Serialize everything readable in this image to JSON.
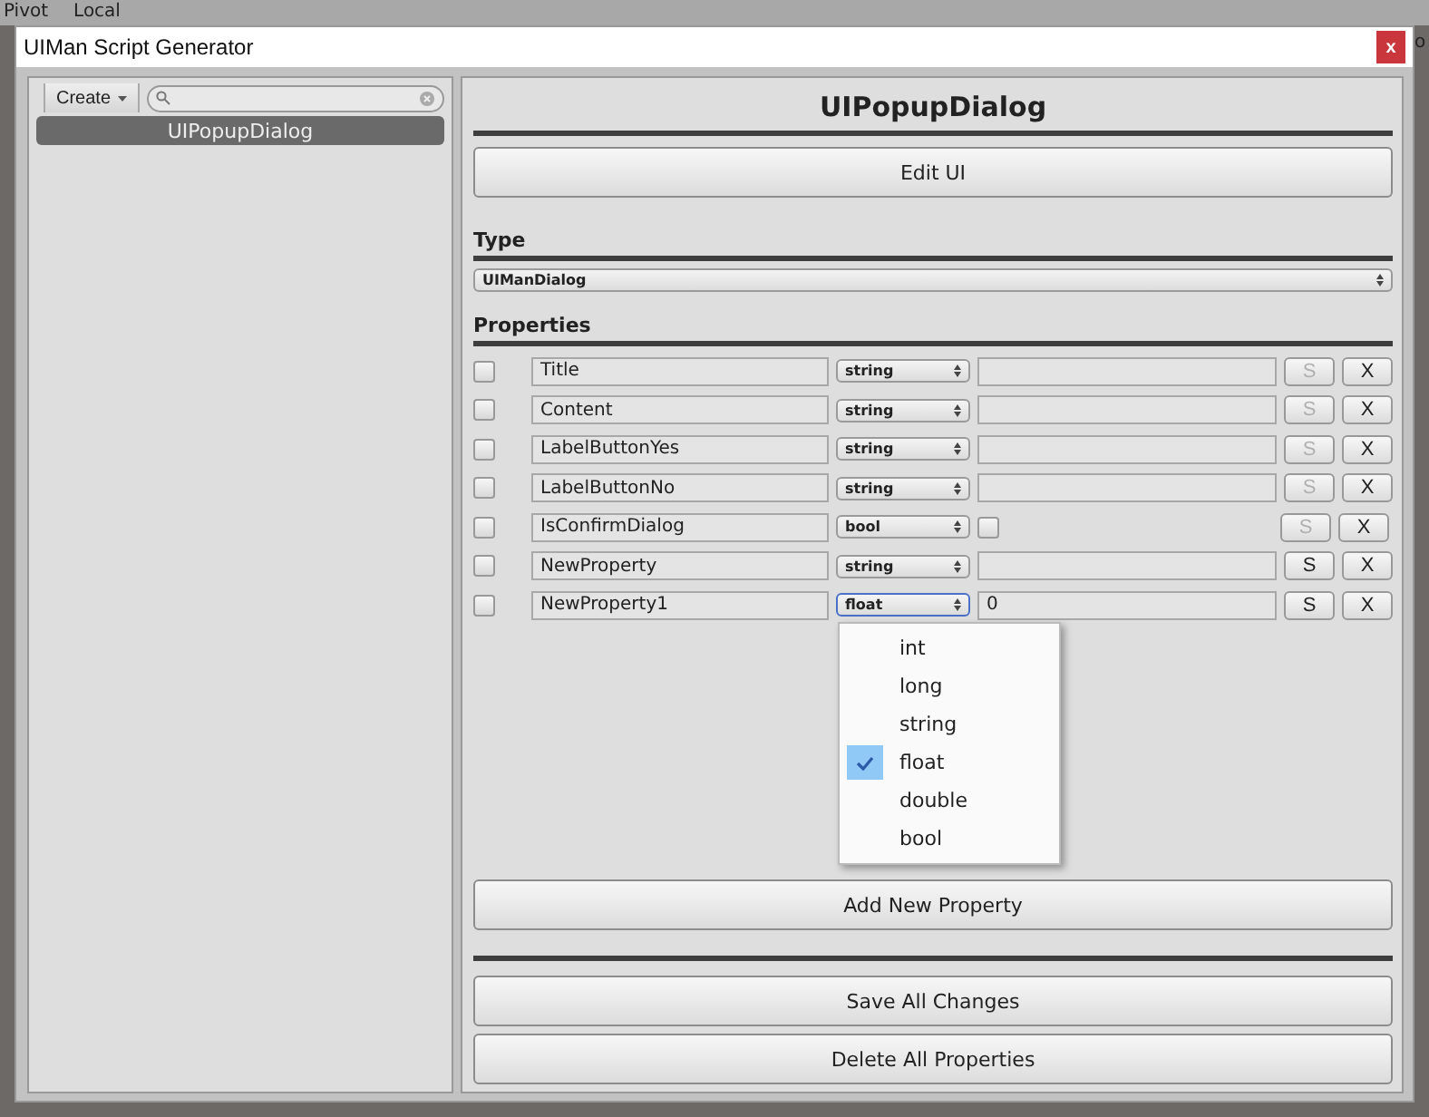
{
  "background": {
    "toolbar_items": [
      "Pivot",
      "Local"
    ],
    "side_text": "o"
  },
  "window": {
    "title": "UIMan Script Generator",
    "close_label": "x"
  },
  "sidebar": {
    "create_button": "Create",
    "items": [
      {
        "label": "UIPopupDialog",
        "selected": true
      }
    ]
  },
  "editor": {
    "title": "UIPopupDialog",
    "edit_button": "Edit UI",
    "type_label": "Type",
    "type_value": "UIManDialog",
    "properties_label": "Properties",
    "properties": [
      {
        "checked": false,
        "name": "Title",
        "type": "string",
        "kind": "text",
        "focused": false,
        "save_enabled": false,
        "save_label": "S",
        "remove_label": "X"
      },
      {
        "checked": false,
        "name": "Content",
        "type": "string",
        "kind": "text",
        "focused": false,
        "save_enabled": false,
        "save_label": "S",
        "remove_label": "X"
      },
      {
        "checked": false,
        "name": "LabelButtonYes",
        "type": "string",
        "kind": "text",
        "focused": false,
        "save_enabled": false,
        "save_label": "S",
        "remove_label": "X"
      },
      {
        "checked": false,
        "name": "LabelButtonNo",
        "type": "string",
        "kind": "text",
        "focused": false,
        "save_enabled": false,
        "save_label": "S",
        "remove_label": "X"
      },
      {
        "checked": false,
        "name": "IsConfirmDialog",
        "type": "bool",
        "kind": "bool",
        "value_checked": false,
        "focused": false,
        "save_enabled": false,
        "save_label": "S",
        "remove_label": "X"
      },
      {
        "checked": false,
        "name": "NewProperty",
        "type": "string",
        "kind": "text",
        "focused": false,
        "save_enabled": true,
        "save_label": "S",
        "remove_label": "X"
      },
      {
        "checked": false,
        "name": "NewProperty1",
        "type": "float",
        "kind": "text",
        "value": "0",
        "focused": true,
        "save_enabled": true,
        "save_label": "S",
        "remove_label": "X"
      }
    ],
    "add_button": "Add New Property",
    "save_button": "Save All Changes",
    "delete_button": "Delete All Properties"
  },
  "dropdown": {
    "options": [
      {
        "label": "int",
        "selected": false
      },
      {
        "label": "long",
        "selected": false
      },
      {
        "label": "string",
        "selected": false
      },
      {
        "label": "float",
        "selected": true
      },
      {
        "label": "double",
        "selected": false
      },
      {
        "label": "bool",
        "selected": false
      }
    ]
  }
}
